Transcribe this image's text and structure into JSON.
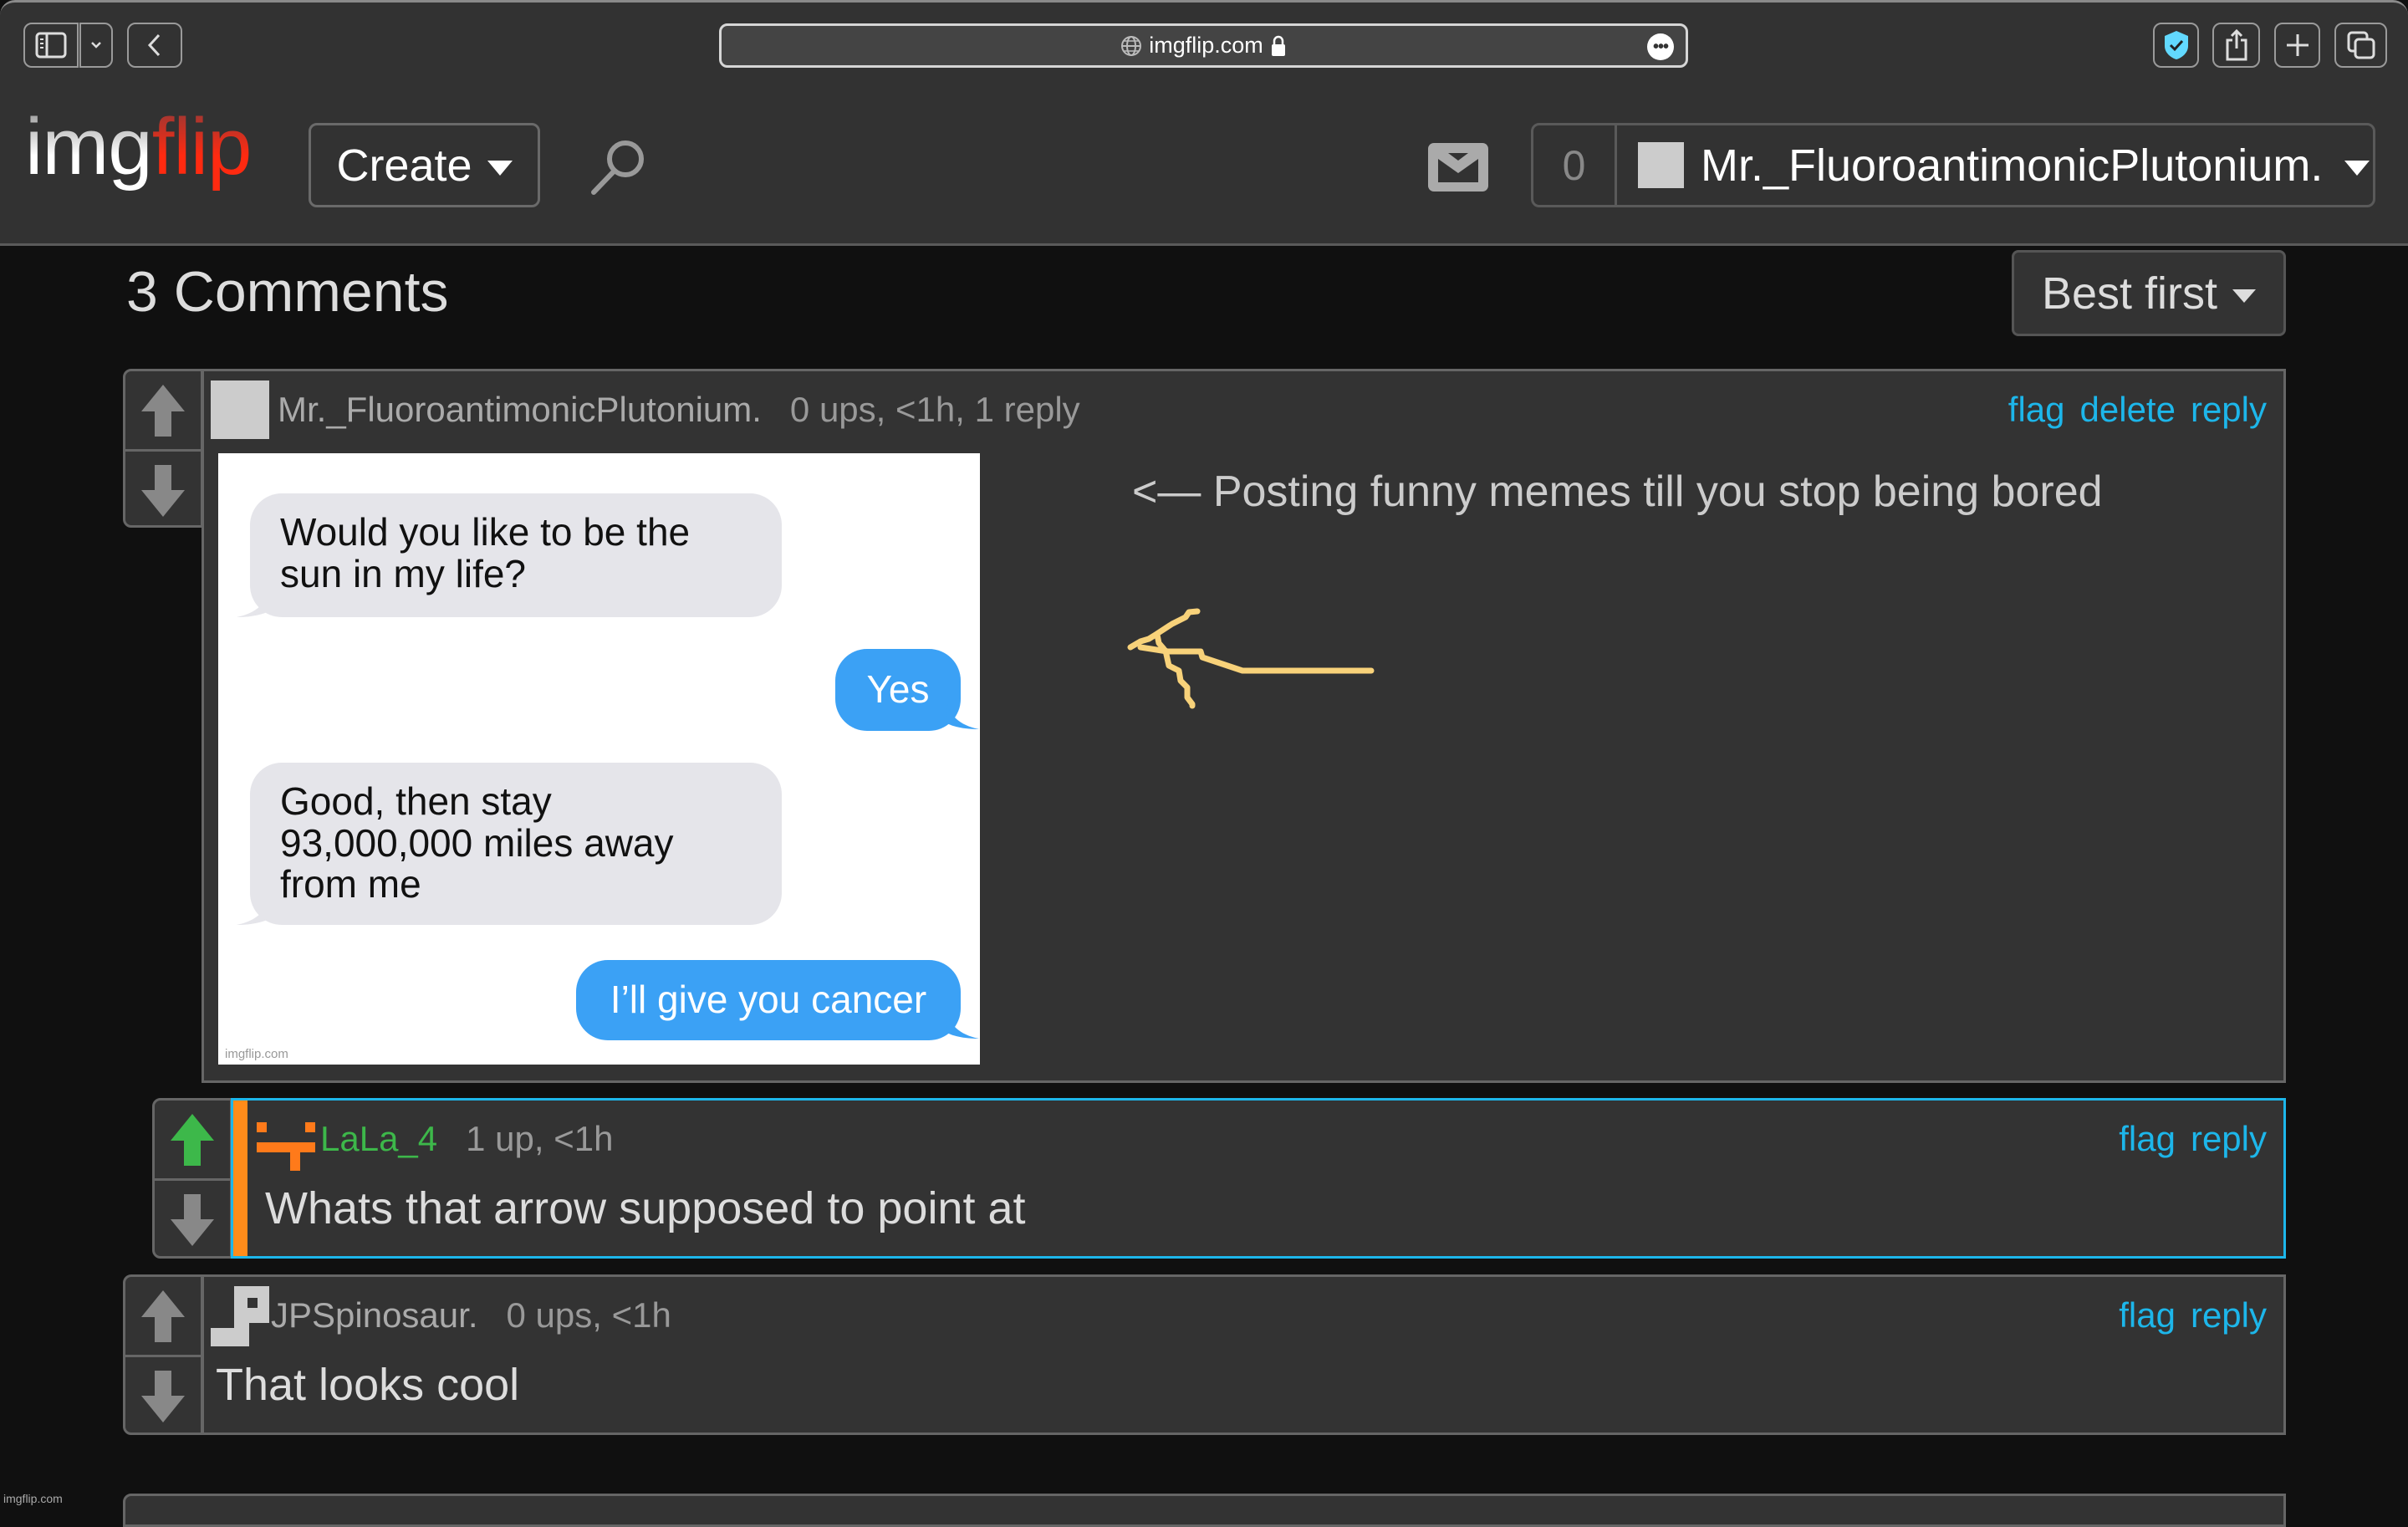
{
  "browser": {
    "url": "imgflip.com",
    "buttons": [
      "sidebar-toggle",
      "tab-group-menu",
      "back",
      "privacy-shield",
      "share",
      "new-tab",
      "tab-overview"
    ]
  },
  "header": {
    "logo_part1": "img",
    "logo_part2": "flip",
    "create_label": "Create",
    "notification_count": "0",
    "username": "Mr._FluoroantimonicPlutonium."
  },
  "comments_section": {
    "title": "3 Comments",
    "sort_label": "Best first",
    "comments": [
      {
        "username": "Mr._FluoroantimonicPlutonium.",
        "stats": "0 ups, <1h, 1 reply",
        "actions": [
          "flag",
          "delete",
          "reply"
        ],
        "caption": "<— Posting funny memes till you stop being bored",
        "meme": {
          "messages": [
            {
              "side": "left",
              "text_lines": [
                "Would you like to be the",
                "sun in my life?"
              ]
            },
            {
              "side": "right",
              "text_lines": [
                "Yes"
              ]
            },
            {
              "side": "left",
              "text_lines": [
                "Good, then stay",
                "93,000,000 miles away",
                "from me"
              ]
            },
            {
              "side": "right",
              "text_lines": [
                "I’ll give you cancer"
              ]
            }
          ],
          "watermark": "imgflip.com"
        },
        "annotation_color": "#f8d27a"
      },
      {
        "username": "LaLa_4",
        "stats": "1 up, <1h",
        "actions": [
          "flag",
          "reply"
        ],
        "text": "Whats that arrow supposed to point at",
        "upvoted": true,
        "is_reply": true
      },
      {
        "username": "JPSpinosaur.",
        "stats": "0 ups, <1h",
        "actions": [
          "flag",
          "reply"
        ],
        "text": "That looks cool"
      }
    ]
  },
  "footer": {
    "watermark": "imgflip.com"
  },
  "colors": {
    "link": "#1db6ea",
    "upvote_active": "#3db84a",
    "reply_highlight_border": "#1db6ea",
    "reply_bar": "#ff8c1a",
    "logo_accent": "#ff2a10",
    "lala_avatar": "#ff7a1a"
  }
}
